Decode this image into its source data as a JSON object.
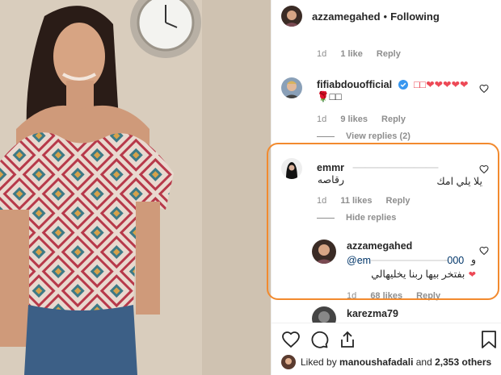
{
  "header": {
    "username": "azzamegahed",
    "separator": "•",
    "follow_status": "Following"
  },
  "top_meta": {
    "time": "1d",
    "likes": "1 like",
    "reply": "Reply"
  },
  "comments": [
    {
      "username": "fifiabdouofficial",
      "verified": true,
      "line1": "□□❤❤❤❤❤",
      "line2": "🌹□□",
      "time": "1d",
      "likes": "9 likes",
      "reply": "Reply",
      "view_replies": "View replies (2)"
    },
    {
      "username": "emmr",
      "redacted": "———————",
      "text1": "يلا يلي امك",
      "text2": "رقاصه",
      "time": "1d",
      "likes": "11 likes",
      "reply": "Reply",
      "hide_replies": "Hide replies"
    },
    {
      "username": "azzamegahed",
      "mention": "@em",
      "mention_redacted": "——————-",
      "mention_end": "000",
      "and": "و",
      "text": "بفتخر بيها ربنا يخليهالي",
      "time": "1d",
      "likes": "68 likes",
      "reply": "Reply"
    },
    {
      "username": "karezma79"
    }
  ],
  "liked_by": {
    "prefix": "Liked by",
    "user": "manoushafadali",
    "middle": "and",
    "others": "2,353 others"
  },
  "colors": {
    "highlight": "#f28a2e",
    "heart_red": "#ed4956",
    "verified_blue": "#3897f0",
    "muted": "#8e8e8e"
  },
  "icons": [
    "heart-icon",
    "comment-icon",
    "share-icon",
    "bookmark-icon",
    "verified-badge-icon"
  ]
}
